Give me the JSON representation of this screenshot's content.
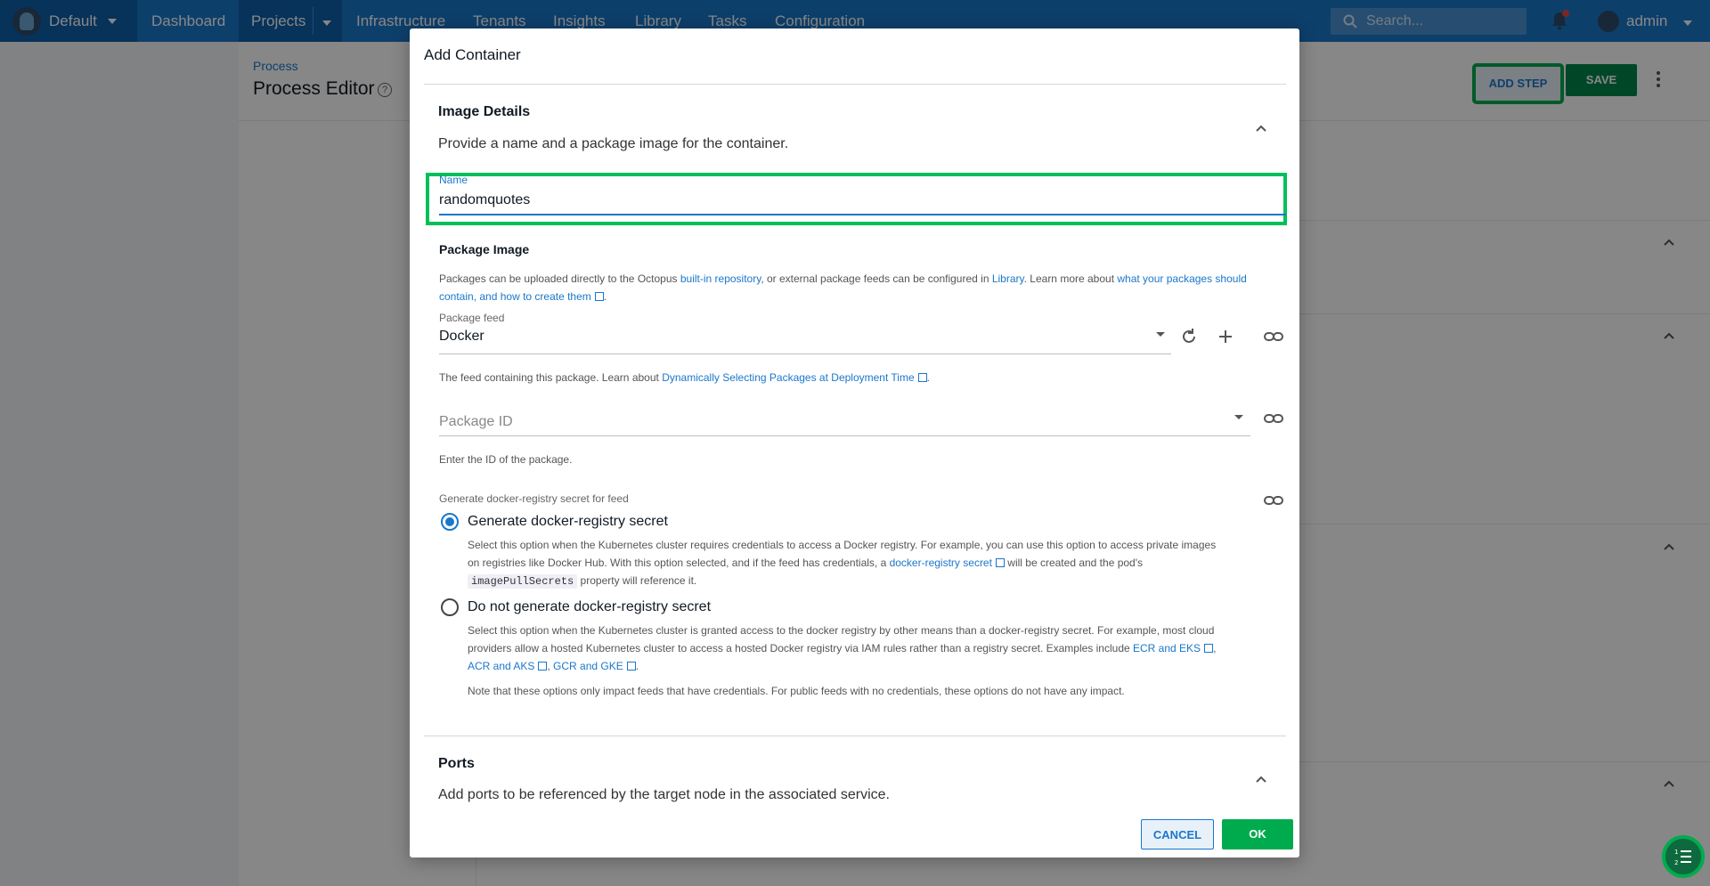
{
  "nav": {
    "space": "Default",
    "items": [
      "Dashboard",
      "Projects",
      "Infrastructure",
      "Tenants",
      "Insights",
      "Library",
      "Tasks",
      "Configuration"
    ],
    "search_placeholder": "Search...",
    "user": "admin"
  },
  "page": {
    "breadcrumb": "Process",
    "title": "Process Editor",
    "add_step": "ADD STEP",
    "save": "SAVE"
  },
  "dialog": {
    "title": "Add Container",
    "image_details": {
      "title": "Image Details",
      "description": "Provide a name and a package image for the container."
    },
    "name": {
      "label": "Name",
      "value": "randomquotes"
    },
    "package_image": {
      "title": "Package Image",
      "help_1": "Packages can be uploaded directly to the Octopus ",
      "help_link_1": "built-in repository",
      "help_2": ", or external package feeds can be configured in ",
      "help_link_2": "Library",
      "help_3": ". Learn more about ",
      "help_link_3a": "what your packages should",
      "help_link_3b": "contain, and how to create them",
      "help_4": "."
    },
    "package_feed": {
      "label": "Package feed",
      "value": "Docker",
      "help": "The feed containing this package. Learn about ",
      "help_link": "Dynamically Selecting Packages at Deployment Time",
      "help_end": "."
    },
    "package_id": {
      "placeholder": "Package ID",
      "help": "Enter the ID of the package."
    },
    "secret": {
      "label": "Generate docker-registry secret for feed",
      "option_1": "Generate docker-registry secret",
      "option_1_help_a": "Select this option when the Kubernetes cluster requires credentials to access a Docker registry. For example, you can use this option to access private images",
      "option_1_help_b": "on registries like Docker Hub. With this option selected, and if the feed has credentials, a ",
      "option_1_link": "docker-registry secret",
      "option_1_help_c": " will be created and the pod's",
      "option_1_code": "imagePullSecrets",
      "option_1_help_d": " property will reference it.",
      "option_2": "Do not generate docker-registry secret",
      "option_2_help_a": "Select this option when the Kubernetes cluster is granted access to the docker registry by other means than a docker-registry secret. For example, most cloud",
      "option_2_help_b": "providers allow a hosted Kubernetes cluster to access a hosted Docker registry via IAM rules rather than a registry secret. Examples include ",
      "option_2_link_1": "ECR and EKS",
      "option_2_help_c": ",",
      "option_2_link_2": "ACR and AKS",
      "option_2_help_d": ", ",
      "option_2_link_3": "GCR and GKE",
      "option_2_help_e": ".",
      "note": "Note that these options only impact feeds that have credentials. For public feeds with no credentials, these options do not have any impact."
    },
    "ports": {
      "title": "Ports",
      "description": "Add ports to be referenced by the target node in the associated service."
    },
    "cancel": "CANCEL",
    "ok": "OK"
  }
}
